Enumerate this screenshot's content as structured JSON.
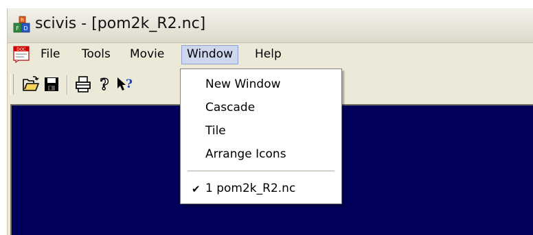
{
  "window": {
    "title": "scivis - [pom2k_R2.nc]",
    "icon": "scivis-app-icon"
  },
  "menubar": {
    "doc_icon": "doc-icon",
    "items": [
      {
        "label": "File"
      },
      {
        "label": "Tools"
      },
      {
        "label": "Movie"
      },
      {
        "label": "Window",
        "active": true
      },
      {
        "label": "Help"
      }
    ]
  },
  "toolbar": {
    "buttons": [
      {
        "icon": "open-folder-icon"
      },
      {
        "icon": "save-disk-icon"
      },
      {
        "icon": "printer-icon"
      },
      {
        "icon": "help-question-icon"
      },
      {
        "icon": "context-help-pointer-icon"
      }
    ]
  },
  "window_menu": {
    "items": [
      {
        "label": "New Window"
      },
      {
        "label": "Cascade"
      },
      {
        "label": "Tile"
      },
      {
        "label": "Arrange Icons"
      }
    ],
    "documents": [
      {
        "label": "1 pom2k_R2.nc",
        "checked": true,
        "check_glyph": "✔"
      }
    ]
  },
  "colors": {
    "client_background": "#00005a",
    "menu_highlight": "#cdd7ee",
    "chrome": "#ece9d8"
  }
}
